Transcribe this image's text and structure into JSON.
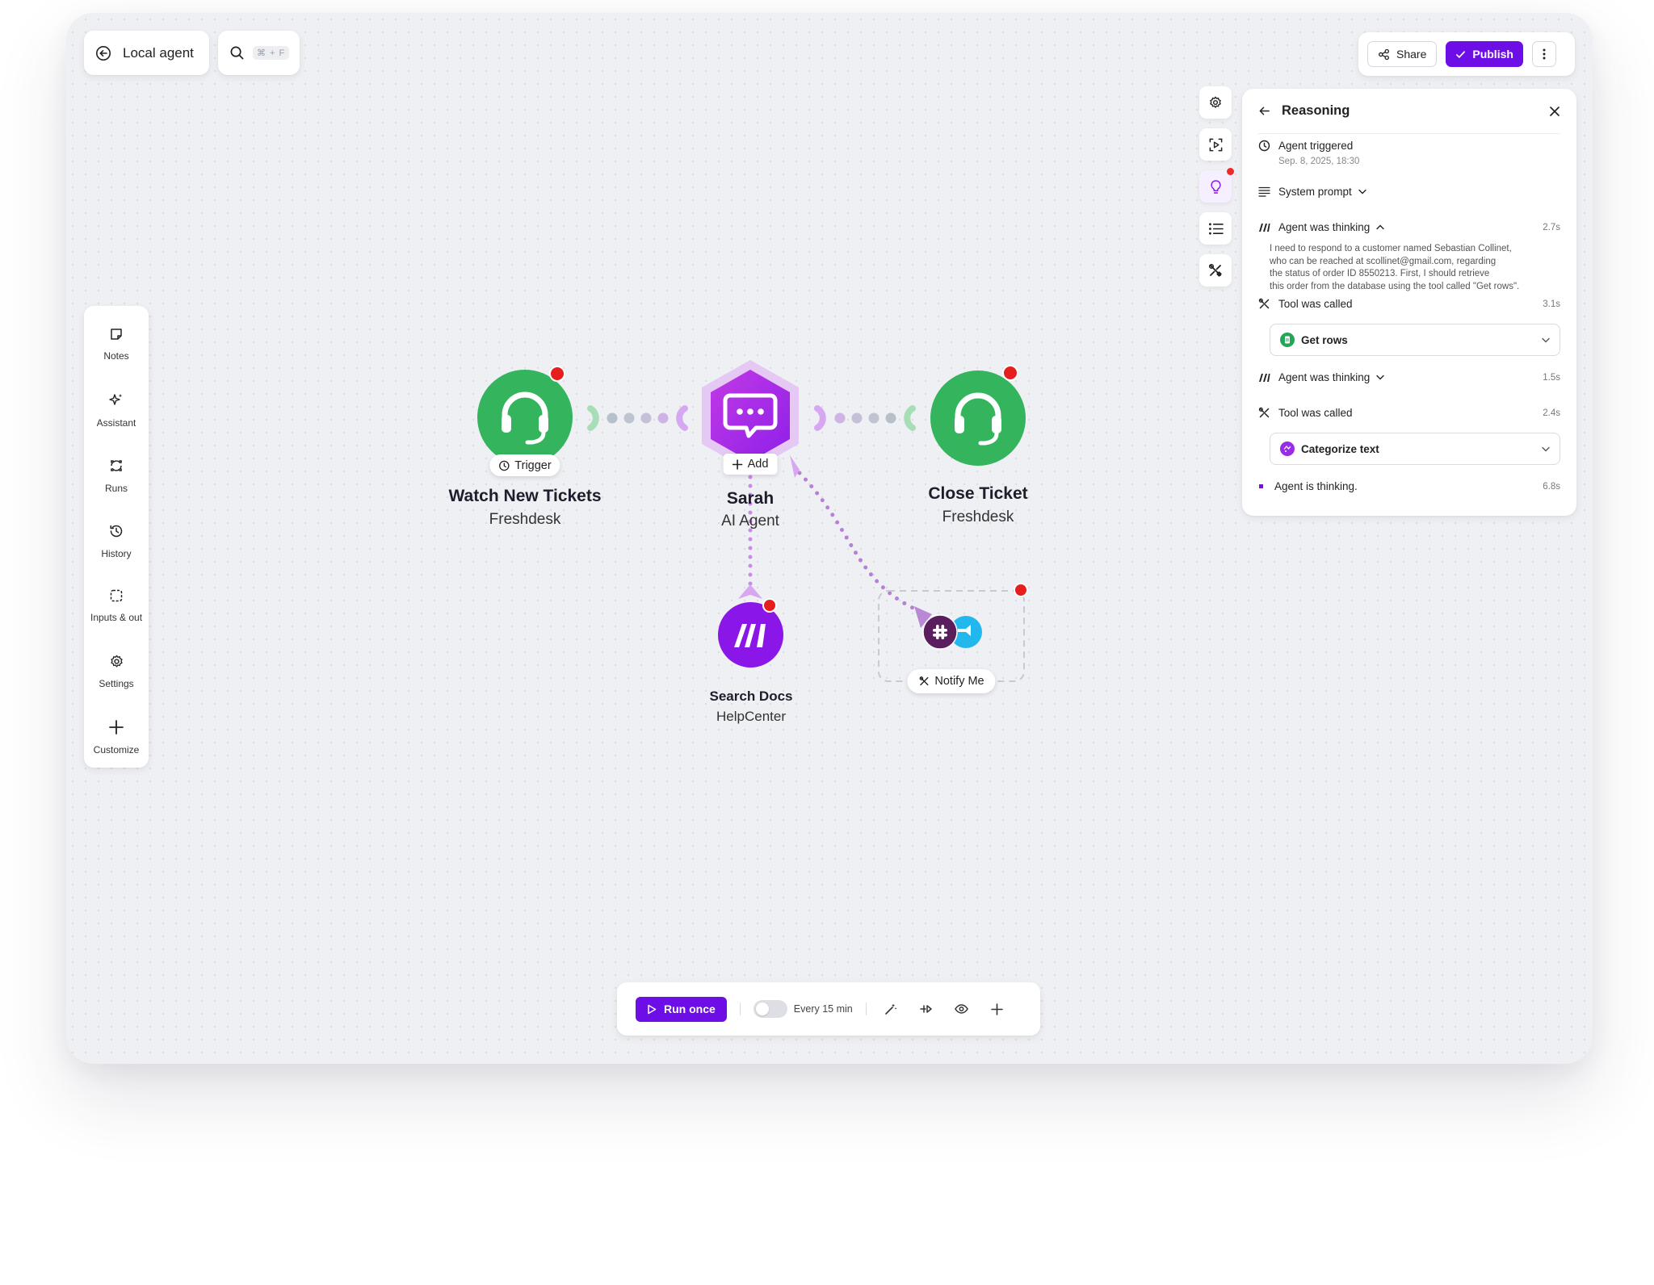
{
  "header": {
    "back_label": "Local agent",
    "search_shortcut": "⌘ + F"
  },
  "toolbar": {
    "share_label": "Share",
    "publish_label": "Publish"
  },
  "sidebar": {
    "items": [
      {
        "label": "Notes",
        "icon": "note-icon"
      },
      {
        "label": "Assistant",
        "icon": "sparkle-icon"
      },
      {
        "label": "Runs",
        "icon": "runs-icon"
      },
      {
        "label": "History",
        "icon": "history-icon"
      },
      {
        "label": "Inputs & outputs",
        "icon": "inputs-icon"
      },
      {
        "label": "Settings",
        "icon": "gear-icon"
      },
      {
        "label": "Customize",
        "icon": "plus-icon"
      }
    ]
  },
  "panel": {
    "title": "Reasoning",
    "triggered_label": "Agent triggered",
    "triggered_time": "Sep. 8, 2025, 18:30",
    "system_prompt_label": "System prompt",
    "thinking1_label": "Agent was thinking",
    "thinking1_duration": "2.7s",
    "thinking1_lines": [
      "I need to respond to a customer named Sebastian Collinet,",
      "who can be reached at scollinet@gmail.com, regarding",
      "the status of order ID 8550213. First, I should retrieve",
      "this order from the database using the tool called \"Get rows\"."
    ],
    "tool1_label": "Tool was called",
    "tool1_duration": "3.1s",
    "tool1_name": "Get rows",
    "thinking2_label": "Agent was thinking",
    "thinking2_duration": "1.5s",
    "tool2_label": "Tool was called",
    "tool2_duration": "2.4s",
    "tool2_name": "Categorize text",
    "status_label": "Agent is thinking.",
    "status_duration": "6.8s"
  },
  "nodes": {
    "trigger": {
      "title": "Watch New Tickets",
      "subtitle": "Freshdesk",
      "badge": "Trigger"
    },
    "agent": {
      "title": "Sarah",
      "subtitle": "AI Agent",
      "badge": "Add"
    },
    "close": {
      "title": "Close Ticket",
      "subtitle": "Freshdesk"
    },
    "search": {
      "title": "Search Docs",
      "subtitle": "HelpCenter"
    },
    "notify": {
      "badge": "Notify Me"
    }
  },
  "bottom_bar": {
    "run_label": "Run once",
    "schedule_label": "Every 15 min"
  },
  "colors": {
    "accent": "#6e0ee6",
    "green": "#34b55f",
    "purple": "#a52ce8",
    "alert": "#e61e1e"
  }
}
